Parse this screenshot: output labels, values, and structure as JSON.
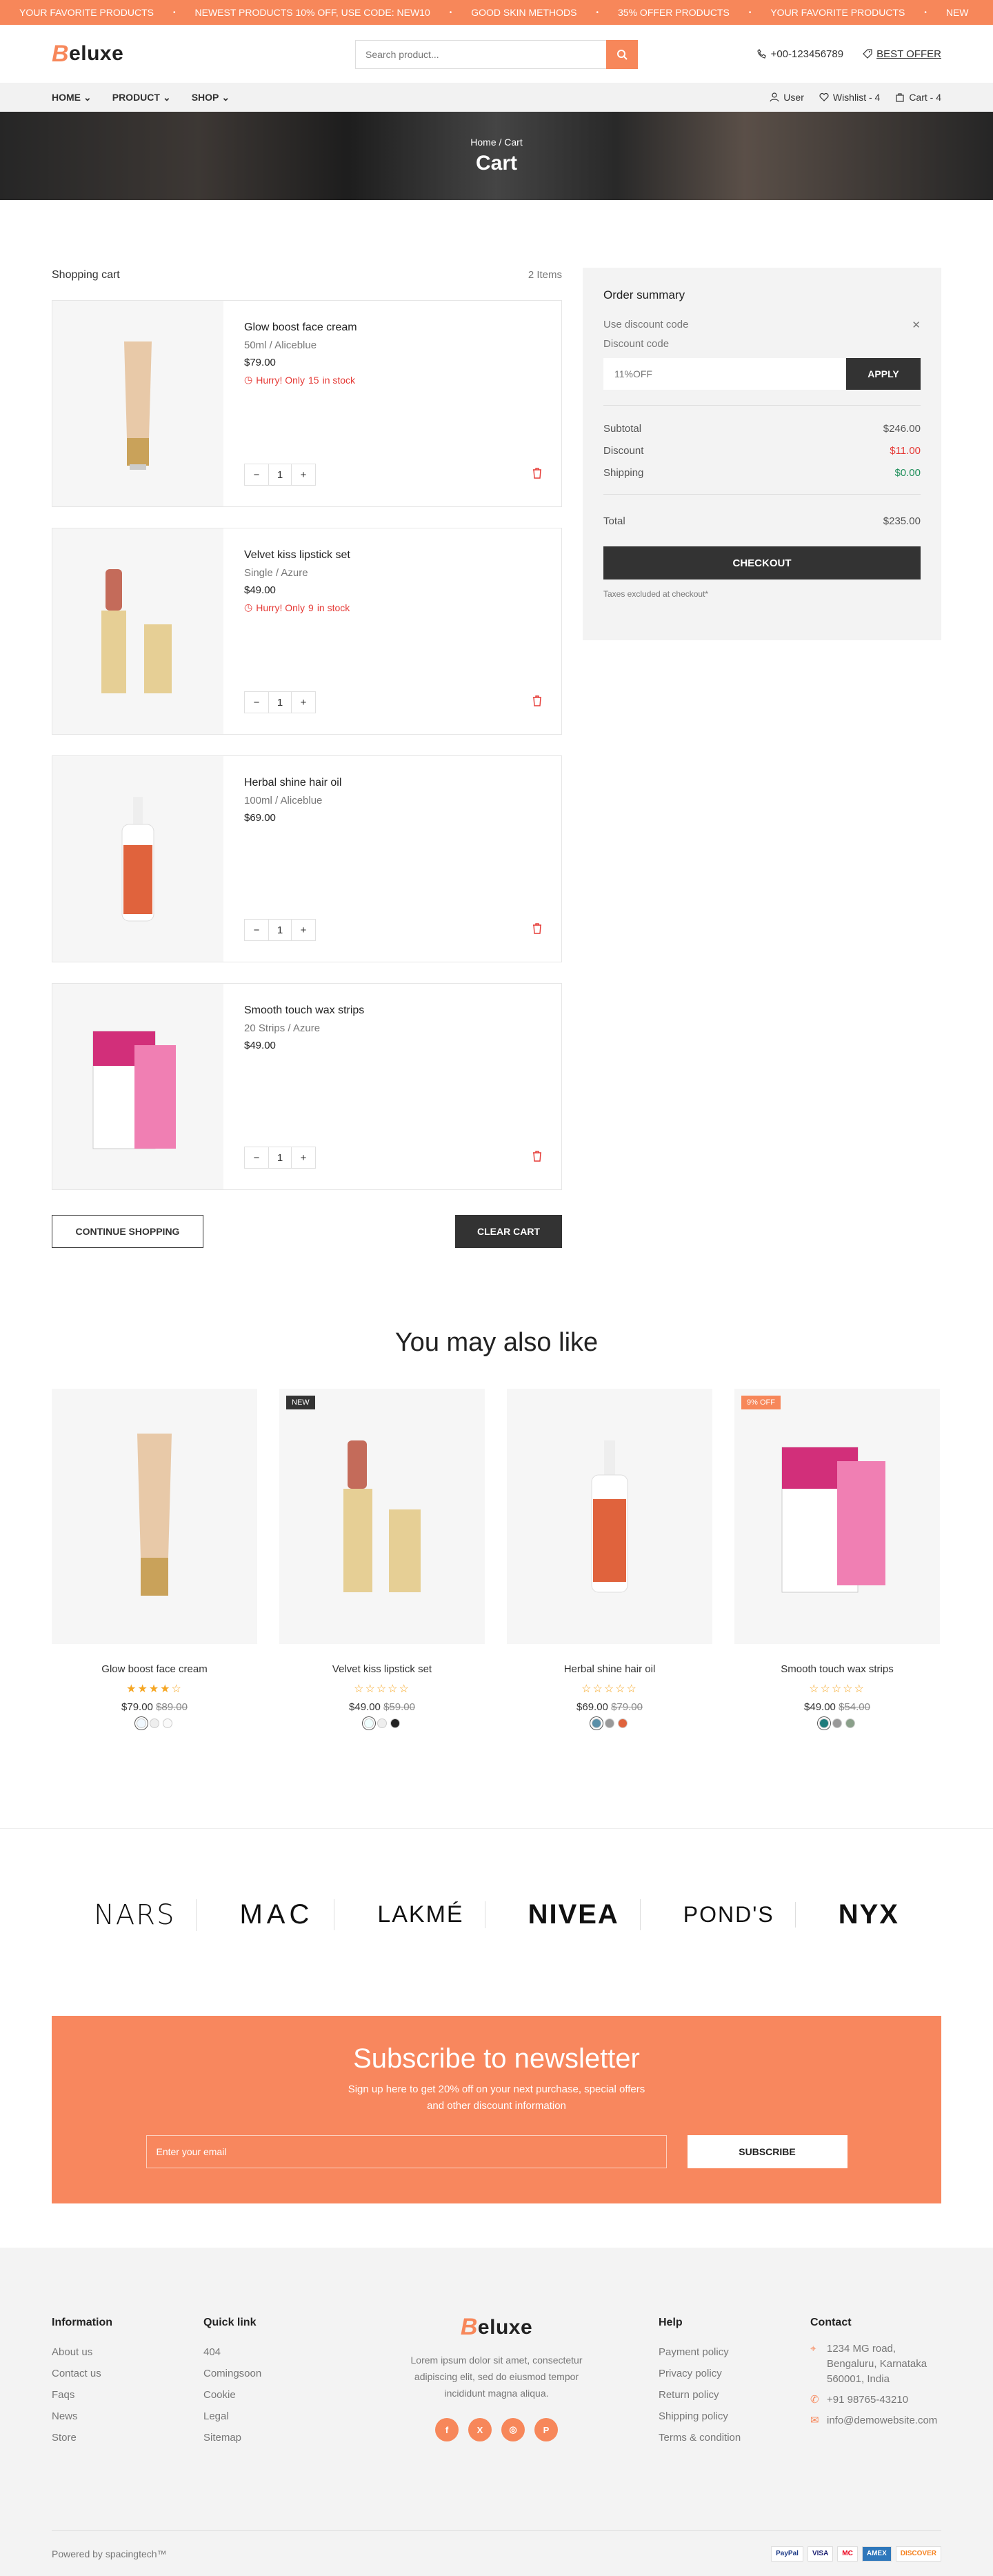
{
  "announcement": {
    "messages": [
      "YOUR FAVORITE PRODUCTS",
      "NEWEST PRODUCTS 10% OFF, USE CODE: NEW10",
      "GOOD SKIN METHODS",
      "35% OFFER PRODUCTS",
      "YOUR FAVORITE PRODUCTS",
      "NEW"
    ]
  },
  "header": {
    "logo_initial": "B",
    "logo_rest": "eluxe",
    "search_placeholder": "Search product...",
    "phone": "+00-123456789",
    "best_offer": "BEST OFFER"
  },
  "nav": {
    "items": [
      "HOME",
      "PRODUCT",
      "SHOP"
    ],
    "user": "User",
    "wishlist": "Wishlist - 4",
    "cart": "Cart - 4"
  },
  "banner": {
    "breadcrumb": "Home / Cart",
    "title": "Cart"
  },
  "cart": {
    "title": "Shopping cart",
    "count": "2 Items",
    "items": [
      {
        "name": "Glow boost face cream",
        "variant": "50ml / Aliceblue",
        "price": "$79.00",
        "stock_prefix": "Hurry! Only",
        "stock_qty": "15",
        "stock_suffix": "in stock",
        "qty": "1"
      },
      {
        "name": "Velvet kiss lipstick set",
        "variant": "Single / Azure",
        "price": "$49.00",
        "stock_prefix": "Hurry! Only",
        "stock_qty": "9",
        "stock_suffix": "in stock",
        "qty": "1"
      },
      {
        "name": "Herbal shine hair oil",
        "variant": "100ml / Aliceblue",
        "price": "$69.00",
        "qty": "1"
      },
      {
        "name": "Smooth touch wax strips",
        "variant": "20 Strips / Azure",
        "price": "$49.00",
        "qty": "1"
      }
    ],
    "continue_label": "CONTINUE SHOPPING",
    "clear_label": "CLEAR CART"
  },
  "summary": {
    "title": "Order summary",
    "use_discount": "Use discount code",
    "discount_label": "Discount code",
    "discount_value": "11%OFF",
    "apply_label": "APPLY",
    "subtotal_label": "Subtotal",
    "subtotal": "$246.00",
    "discount_row_label": "Discount",
    "discount": "$11.00",
    "shipping_label": "Shipping",
    "shipping": "$0.00",
    "total_label": "Total",
    "total": "$235.00",
    "checkout_label": "CHECKOUT",
    "tax_note": "Taxes excluded at checkout*"
  },
  "recommend": {
    "title": "You may also like",
    "products": [
      {
        "name": "Glow boost face cream",
        "price": "$79.00",
        "old_price": "$89.00",
        "badge": "",
        "rating": 4
      },
      {
        "name": "Velvet kiss lipstick set",
        "price": "$49.00",
        "old_price": "$59.00",
        "badge": "NEW",
        "rating": 0
      },
      {
        "name": "Herbal shine hair oil",
        "price": "$69.00",
        "old_price": "$79.00",
        "badge": "",
        "rating": 0
      },
      {
        "name": "Smooth touch wax strips",
        "price": "$49.00",
        "old_price": "$54.00",
        "badge": "9% OFF",
        "rating": 0
      }
    ]
  },
  "brands": [
    "NARS",
    "MAC",
    "LAKMÉ",
    "NIVEA",
    "POND'S",
    "NYX"
  ],
  "newsletter": {
    "title": "Subscribe to newsletter",
    "text": "Sign up here to get 20% off on your next purchase, special offers and other discount information",
    "placeholder": "Enter your email",
    "button": "SUBSCRIBE"
  },
  "footer": {
    "info_title": "Information",
    "info_links": [
      "About us",
      "Contact us",
      "Faqs",
      "News",
      "Store"
    ],
    "quick_title": "Quick link",
    "quick_links": [
      "404",
      "Comingsoon",
      "Cookie",
      "Legal",
      "Sitemap"
    ],
    "about_text": "Lorem ipsum dolor sit amet, consectetur adipiscing elit, sed do eiusmod tempor incididunt magna aliqua.",
    "help_title": "Help",
    "help_links": [
      "Payment policy",
      "Privacy policy",
      "Return policy",
      "Shipping policy",
      "Terms & condition"
    ],
    "contact_title": "Contact",
    "address": "1234 MG road, Bengaluru, Karnataka 560001, India",
    "phone": "+91 98765-43210",
    "email": "info@demowebsite.com",
    "powered": "Powered by spacingtech™",
    "payments": [
      "PayPal",
      "VISA",
      "MC",
      "AMEX",
      "DISCOVER"
    ]
  },
  "colors": {
    "accent": "#f7875a",
    "dark": "#333333",
    "danger": "#e53935",
    "success": "#1e8e5a"
  }
}
